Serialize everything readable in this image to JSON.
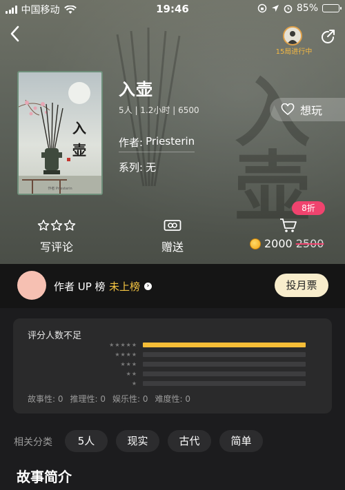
{
  "status_bar": {
    "carrier": "中国移动",
    "time": "19:46",
    "battery": "85%",
    "battery_level": 0.85
  },
  "header": {
    "games_running": "15局进行中"
  },
  "game": {
    "title": "入壶",
    "meta": "5人 | 1.2小时 | 6500",
    "author_label": "作者:",
    "author": "Priesterin",
    "series_label": "系列:",
    "series": "无",
    "want_label": "想玩",
    "cover": {
      "calligraphy": "入壶",
      "caption": "作者 Priesterin"
    }
  },
  "actions": {
    "review_label": "写评论",
    "gift_label": "赠送",
    "discount": "8折",
    "price": "2000",
    "original_price": "2500"
  },
  "author_up": {
    "label": "作者 UP 榜",
    "status": "未上榜",
    "vote_label": "投月票"
  },
  "rating": {
    "title": "评分人数不足",
    "rows": [
      {
        "stars": "★★★★★",
        "fraction": 1.0
      },
      {
        "stars": "★★★★",
        "fraction": 0.0
      },
      {
        "stars": "★★★",
        "fraction": 0.0
      },
      {
        "stars": "★★",
        "fraction": 0.0
      },
      {
        "stars": "★",
        "fraction": 0.0
      }
    ],
    "scores": [
      {
        "label": "故事性:",
        "value": "0"
      },
      {
        "label": "推理性:",
        "value": "0"
      },
      {
        "label": "娱乐性:",
        "value": "0"
      },
      {
        "label": "难度性:",
        "value": "0"
      }
    ]
  },
  "categories": {
    "label": "相关分类",
    "items": [
      "5人",
      "现实",
      "古代",
      "简单"
    ]
  },
  "story": {
    "section_title": "故事简介"
  },
  "colors": {
    "accent_gold": "#f6bd37",
    "discount_pink": "#f0436e",
    "up_status": "#f5c542"
  }
}
